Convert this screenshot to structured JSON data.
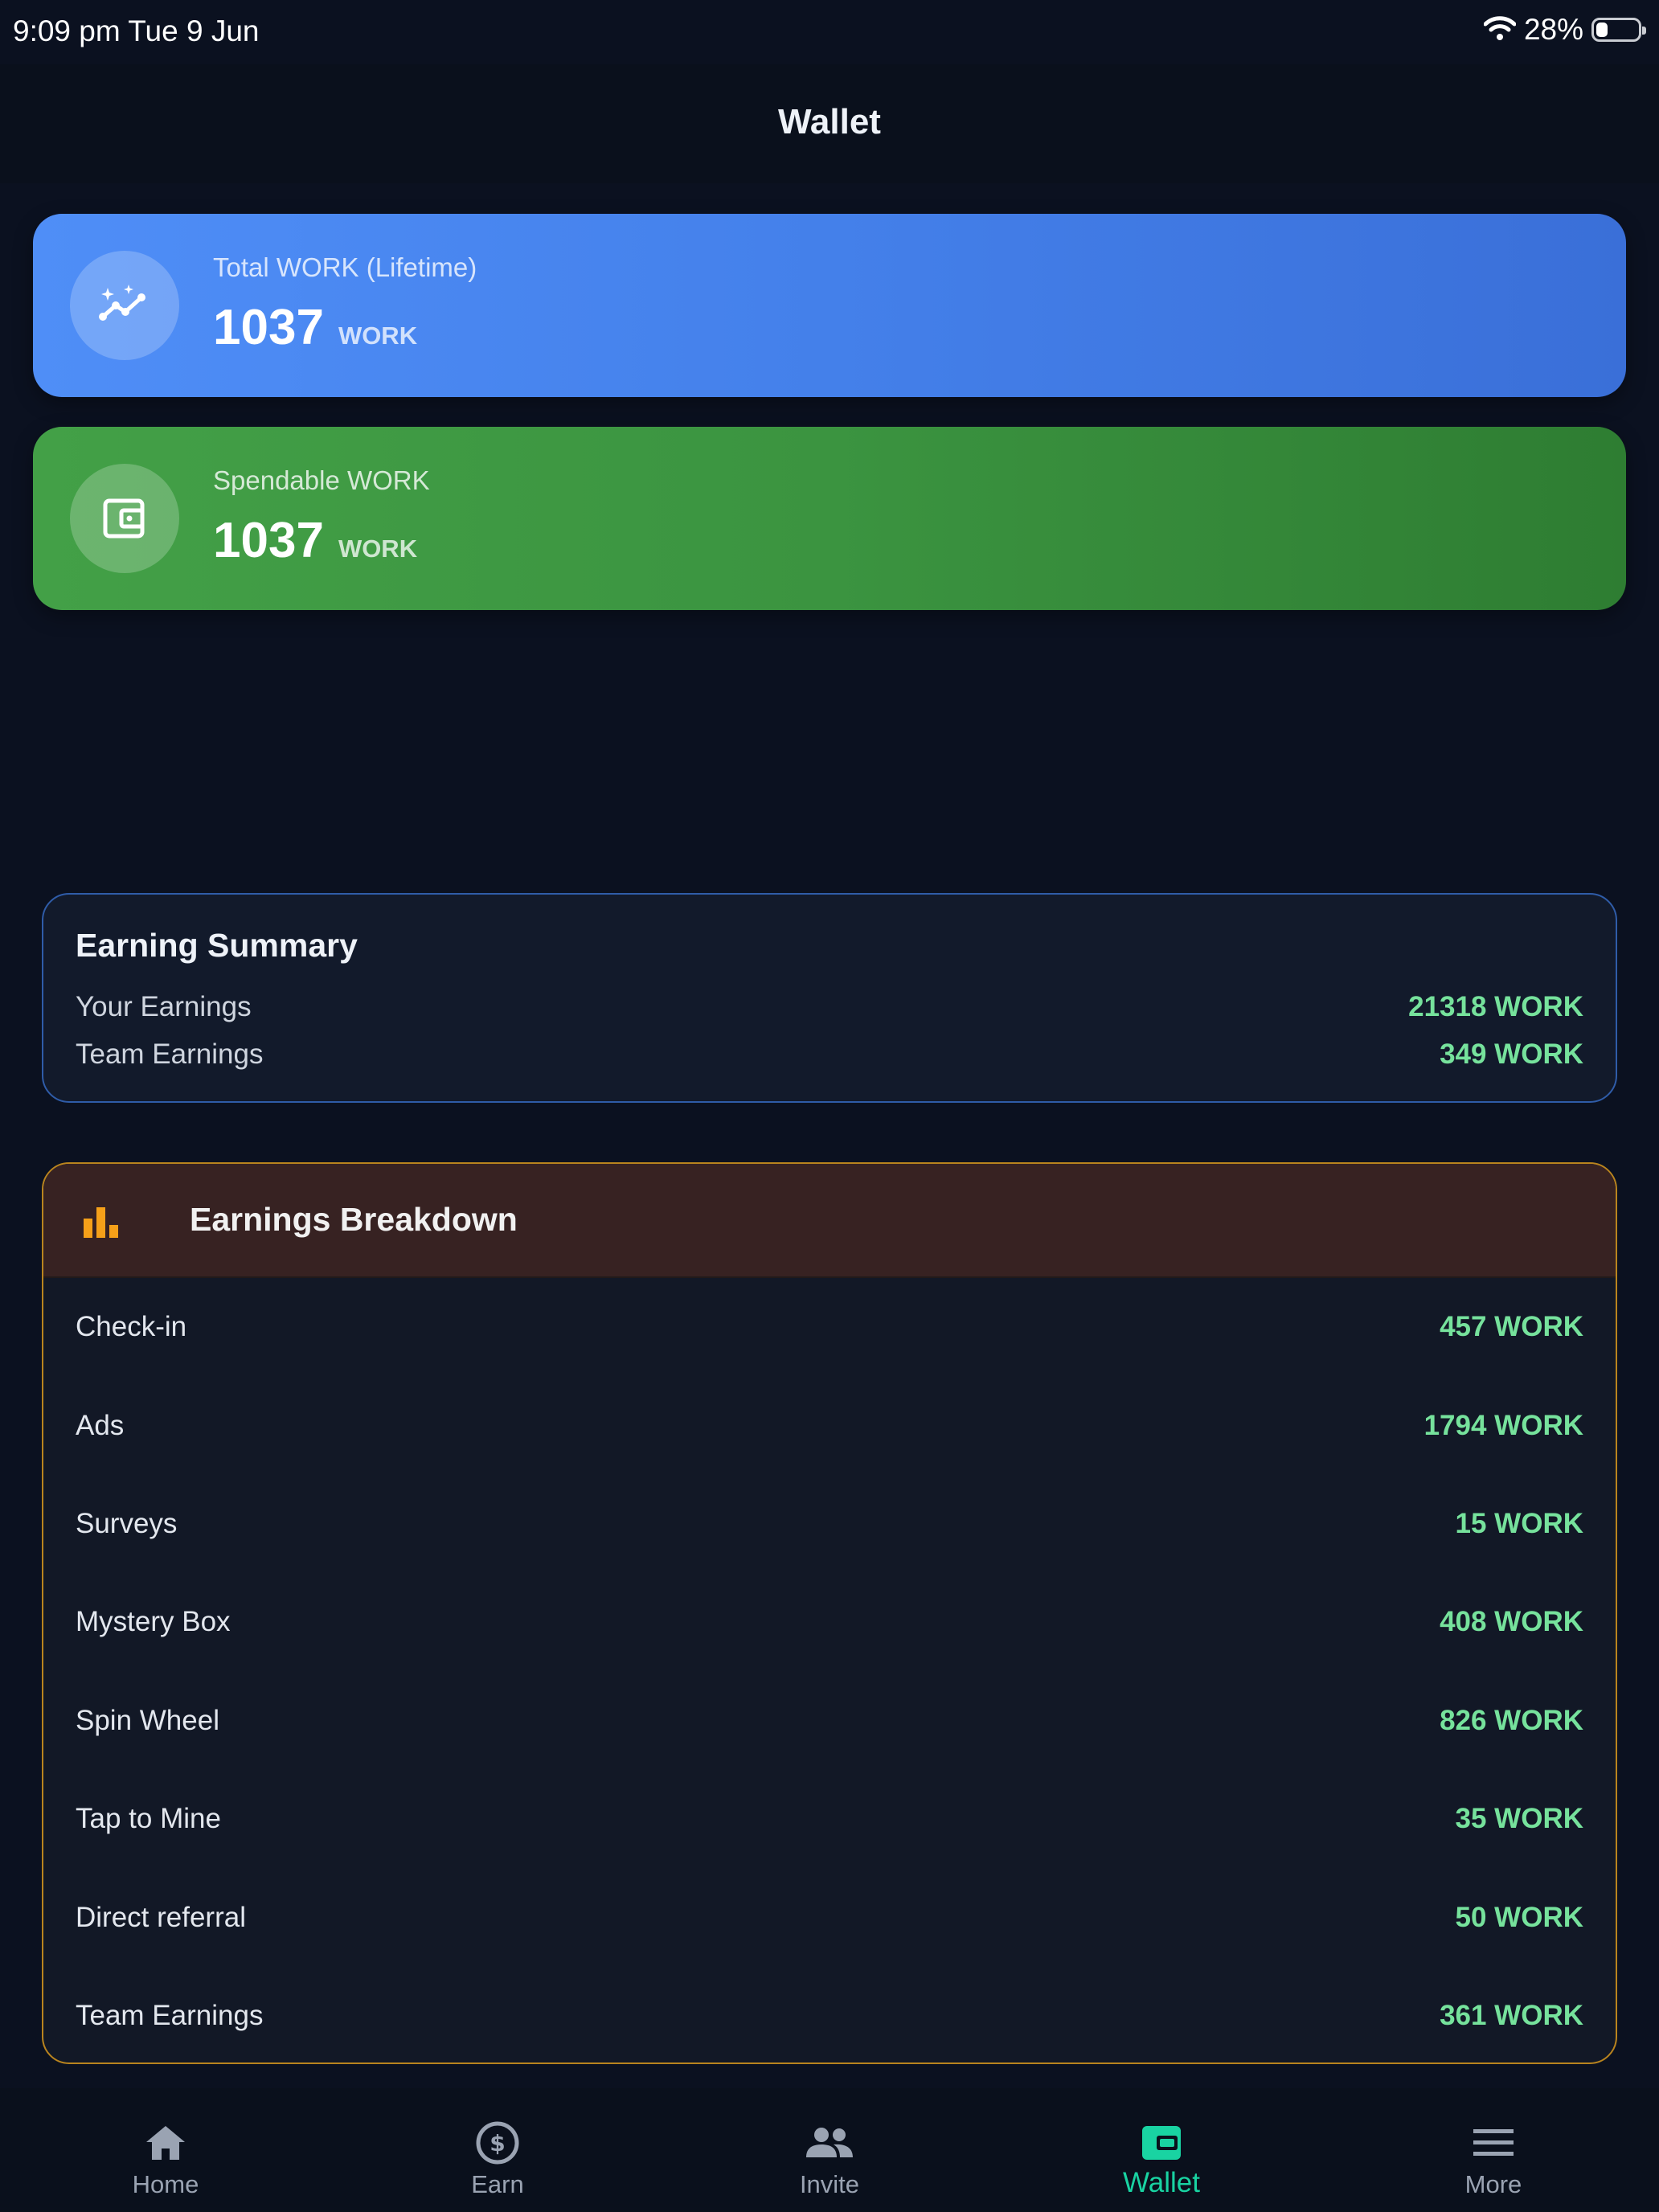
{
  "status_bar": {
    "time": "9:09 pm   Tue 9 Jun",
    "battery": "28%",
    "battery_level": 0.28
  },
  "header": {
    "title": "Wallet"
  },
  "cards": [
    {
      "label": "Total WORK (Lifetime)",
      "value": "1037",
      "unit": "WORK",
      "icon": "trending-sparkle-icon",
      "color": "#4f8ef7"
    },
    {
      "label": "Spendable WORK",
      "value": "1037",
      "unit": "WORK",
      "icon": "wallet-icon",
      "color": "#43a047"
    }
  ],
  "summary": {
    "title": "Earning Summary",
    "rows": [
      {
        "label": "Your Earnings",
        "value": "21318 WORK"
      },
      {
        "label": "Team Earnings",
        "value": "349 WORK"
      }
    ]
  },
  "breakdown": {
    "title": "Earnings Breakdown",
    "icon": "bar-chart-icon",
    "rows": [
      {
        "label": "Check-in",
        "value": "457 WORK"
      },
      {
        "label": "Ads",
        "value": "1794 WORK"
      },
      {
        "label": "Surveys",
        "value": "15 WORK"
      },
      {
        "label": "Mystery Box",
        "value": "408 WORK"
      },
      {
        "label": "Spin Wheel",
        "value": "826 WORK"
      },
      {
        "label": "Tap to Mine",
        "value": "35 WORK"
      },
      {
        "label": "Direct referral",
        "value": "50 WORK"
      },
      {
        "label": "Team Earnings",
        "value": "361 WORK"
      }
    ]
  },
  "tabs": [
    {
      "label": "Home",
      "icon": "home-icon",
      "active": false
    },
    {
      "label": "Earn",
      "icon": "dollar-circle-icon",
      "active": false
    },
    {
      "label": "Invite",
      "icon": "people-icon",
      "active": false
    },
    {
      "label": "Wallet",
      "icon": "wallet-icon",
      "active": true
    },
    {
      "label": "More",
      "icon": "menu-icon",
      "active": false
    }
  ],
  "colors": {
    "accent": "#19d3a2",
    "positive": "#76e29c",
    "summary_border": "#2f5ca8",
    "breakdown_border": "#b9841e"
  }
}
